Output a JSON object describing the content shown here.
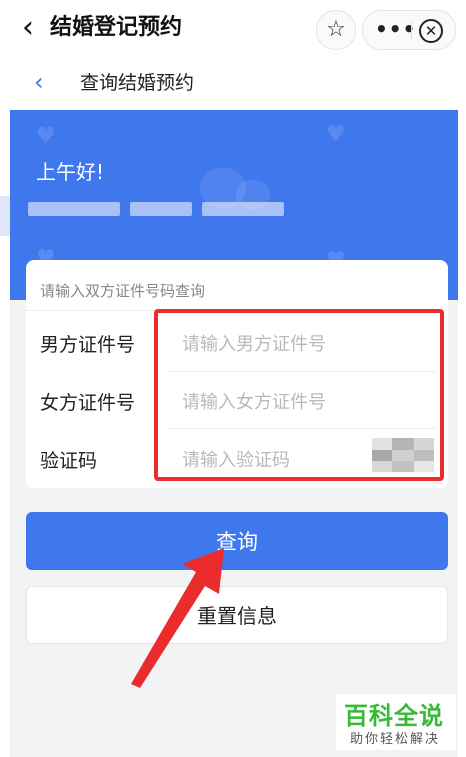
{
  "app": {
    "title": "结婚登记预约",
    "back_icon": "chevron-left-icon",
    "star_icon": "star-icon",
    "more_icon": "more-dots-icon",
    "close_icon": "close-circle-icon"
  },
  "subheader": {
    "title": "查询结婚预约",
    "back_icon": "chevron-left-icon"
  },
  "banner": {
    "greeting": "上午好!"
  },
  "form": {
    "hint": "请输入双方证件号码查询",
    "fields": [
      {
        "label": "男方证件号",
        "placeholder": "请输入男方证件号",
        "value": ""
      },
      {
        "label": "女方证件号",
        "placeholder": "请输入女方证件号",
        "value": ""
      },
      {
        "label": "验证码",
        "placeholder": "请输入验证码",
        "value": ""
      }
    ]
  },
  "buttons": {
    "query_label": "查询",
    "reset_label": "重置信息"
  },
  "watermark": {
    "title": "百科全说",
    "subtitle": "助你轻松解决"
  },
  "colors": {
    "accent": "#3f77ed",
    "highlight": "#ea2c2c",
    "watermark": "#39b83a"
  }
}
